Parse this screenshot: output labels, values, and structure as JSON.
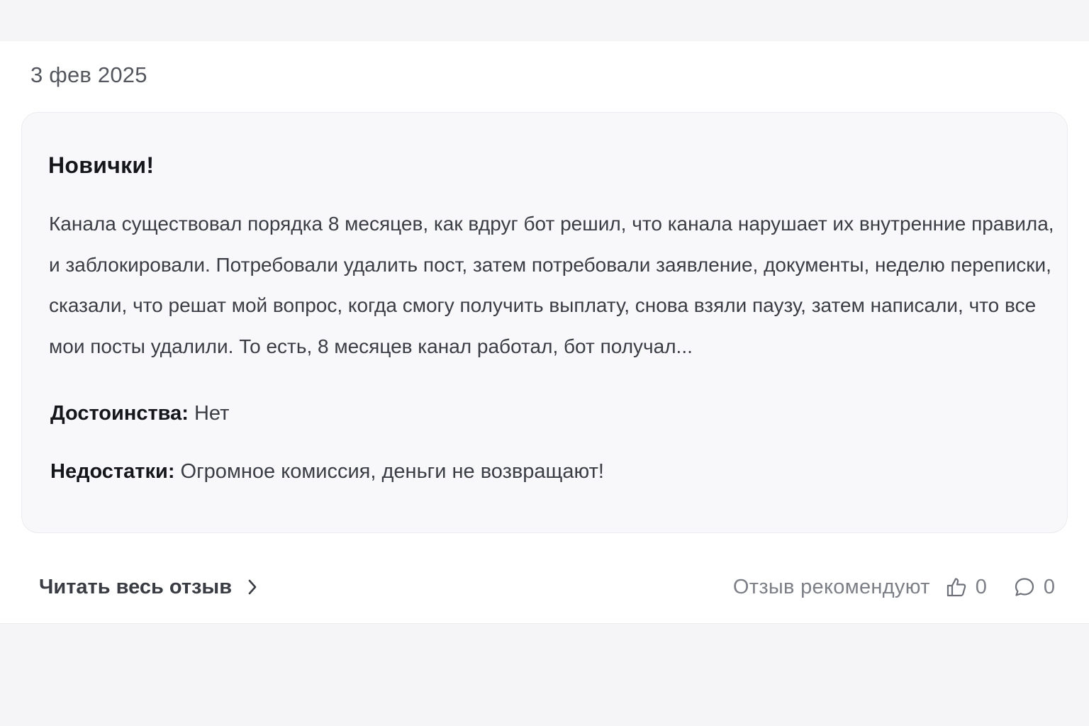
{
  "review": {
    "date": "3 фев 2025",
    "title": "Новички!",
    "body": "Канала существовал порядка 8 месяцев, как вдруг бот решил, что канала нарушает их внутренние правила, и заблокировали. Потребовали удалить пост, затем потребовали заявление, документы, неделю переписки, сказали, что решат мой вопрос, когда смогу получить выплату, снова взяли паузу, затем написали, что все мои посты удалили. То есть, 8 месяцев канал работал, бот получал...",
    "pros_label": "Достоинства:",
    "pros_value": "Нет",
    "cons_label": "Недостатки:",
    "cons_value": "Огромное комиссия, деньги не возвращают!"
  },
  "footer": {
    "read_more_label": "Читать весь отзыв",
    "recommend_label": "Отзыв рекомендуют",
    "likes_count": "0",
    "comments_count": "0"
  },
  "icons": {
    "read_more": "chevron-right-icon",
    "like": "thumbs-up-icon",
    "comment": "speech-bubble-icon"
  },
  "colors": {
    "page_background": "#f5f5f7",
    "panel_background": "#ffffff",
    "card_background": "#f8f8fa",
    "title_text": "#15161a",
    "body_text": "#3b3d45",
    "muted_text": "#7d7f87"
  }
}
